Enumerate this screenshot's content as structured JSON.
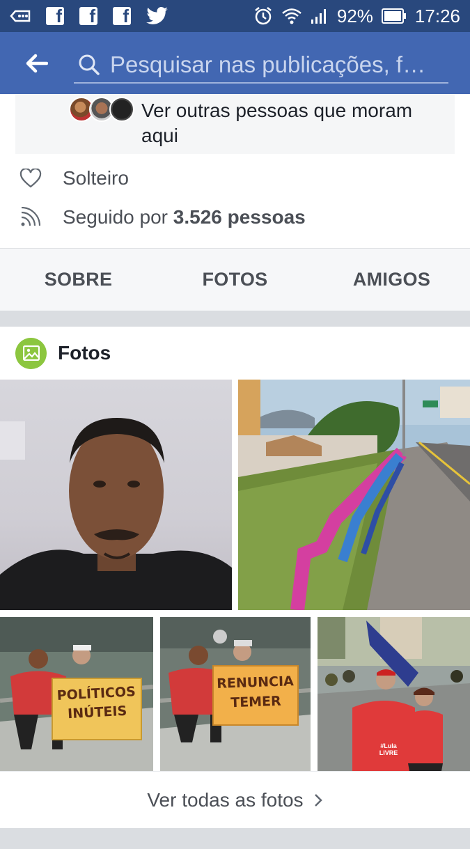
{
  "status_bar": {
    "battery": "92%",
    "time": "17:26"
  },
  "search": {
    "placeholder": "Pesquisar nas publicações, f…"
  },
  "people_box": {
    "text": "Ver outras pessoas que moram aqui"
  },
  "info": {
    "relationship": "Solteiro",
    "followed_prefix": "Seguido por",
    "followed_count": "3.526 pessoas"
  },
  "tabs": [
    "SOBRE",
    "FOTOS",
    "AMIGOS"
  ],
  "photos": {
    "title": "Fotos",
    "sign_1": "POLÍTICOS INÚTEIS",
    "sign_2": "RENUNCIA TEMER",
    "shirt_text": "#Lula LIVRE",
    "see_all": "Ver todas as fotos"
  },
  "colors": {
    "status_bar": "#29487d",
    "header": "#4267b2",
    "photos_icon": "#8cc63f"
  }
}
